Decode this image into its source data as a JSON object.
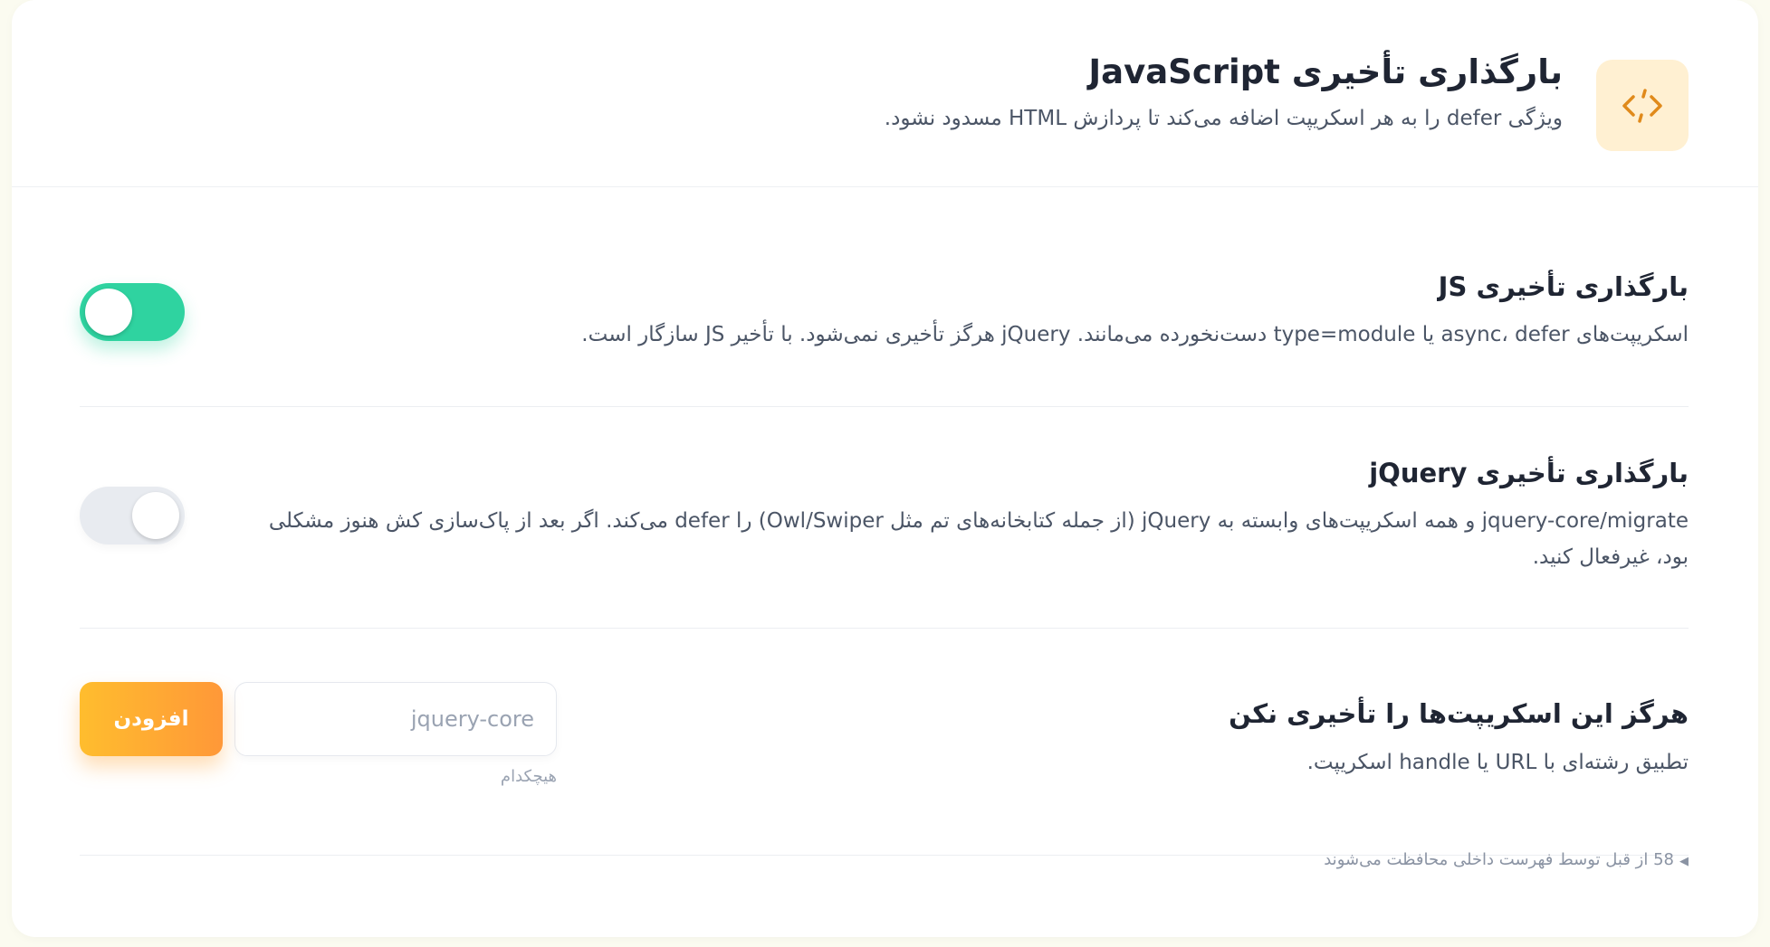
{
  "header": {
    "icon": "code-icon",
    "title": "بارگذاری تأخیری JavaScript",
    "description": "ویژگی defer را به هر اسکریپت اضافه می‌کند تا پردازش HTML مسدود نشود."
  },
  "settings": [
    {
      "title": "بارگذاری تأخیری JS",
      "description": "اسکریپت‌های async، defer یا type=module دست‌نخورده می‌مانند. jQuery هرگز تأخیری نمی‌شود. با تأخیر JS سازگار است.",
      "enabled": true
    },
    {
      "title": "بارگذاری تأخیری jQuery",
      "description": "jquery-core/migrate و همه اسکریپت‌های وابسته به jQuery (از جمله کتابخانه‌های تم مثل Owl/Swiper) را defer می‌کند. اگر بعد از پاک‌سازی کش هنوز مشکلی بود، غیرفعال کنید.",
      "enabled": false
    }
  ],
  "exclusions": {
    "title": "هرگز این اسکریپت‌ها را تأخیری نکن",
    "description": "تطبیق رشته‌ای با URL یا handle اسکریپت.",
    "input_placeholder": "jquery-core",
    "input_value": "",
    "add_label": "افزودن",
    "empty_label": "هیچکدام",
    "footer_note": "58 از قبل توسط فهرست داخلی محافظت می‌شوند"
  },
  "colors": {
    "accent": "#ffa933",
    "toggle_on": "#2fd3a0",
    "toggle_off": "#e8ebf0",
    "icon_bg": "#fff0d2"
  }
}
